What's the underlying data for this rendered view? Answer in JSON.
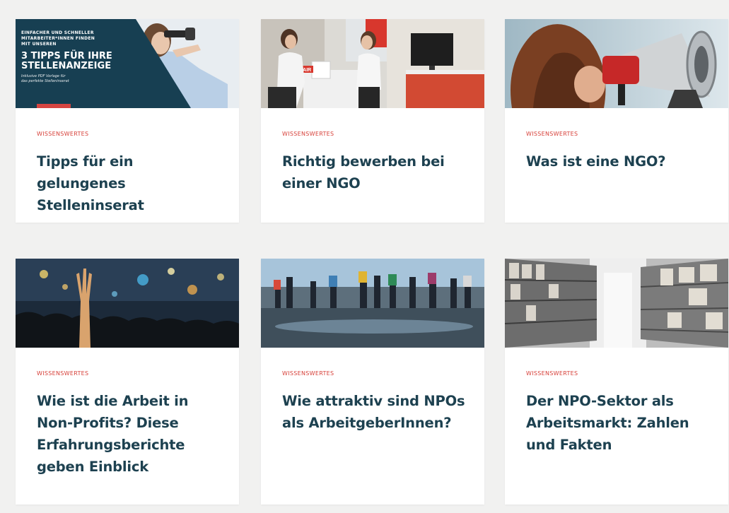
{
  "cards": [
    {
      "category": "WISSENSWERTES",
      "title": "Tipps für ein gelungenes Stelleninserat",
      "image": "job-ad-banner-binoculars",
      "banner": {
        "line1": "EINFACHER UND SCHNELLER",
        "line2": "MITARBEITER*INNEN FINDEN",
        "line3": "MIT UNSEREN",
        "headline1": "3 TIPPS FÜR IHRE",
        "headline2": "STELLENANZEIGE",
        "note1": "Inklusive PDF Vorlage für",
        "note2": "das perfekte Stelleninserat"
      }
    },
    {
      "category": "WISSENSWERTES",
      "title": "Richtig bewerben bei einer NGO",
      "image": "booth-interview-photo",
      "sign": "ON AIR"
    },
    {
      "category": "WISSENSWERTES",
      "title": "Was ist eine NGO?",
      "image": "megaphone-photo"
    },
    {
      "category": "WISSENSWERTES",
      "title": "Wie ist die Arbeit in Non-Profits? Diese Erfahrungsberichte geben Einblick",
      "image": "crowd-night-photo"
    },
    {
      "category": "WISSENSWERTES",
      "title": "Wie attraktiv sind NPOs als ArbeitgeberInnen?",
      "image": "mudflat-hikers-photo"
    },
    {
      "category": "WISSENSWERTES",
      "title": "Der NPO-Sektor als Arbeitsmarkt: Zahlen und Fakten",
      "image": "archive-shelves-photo"
    }
  ]
}
